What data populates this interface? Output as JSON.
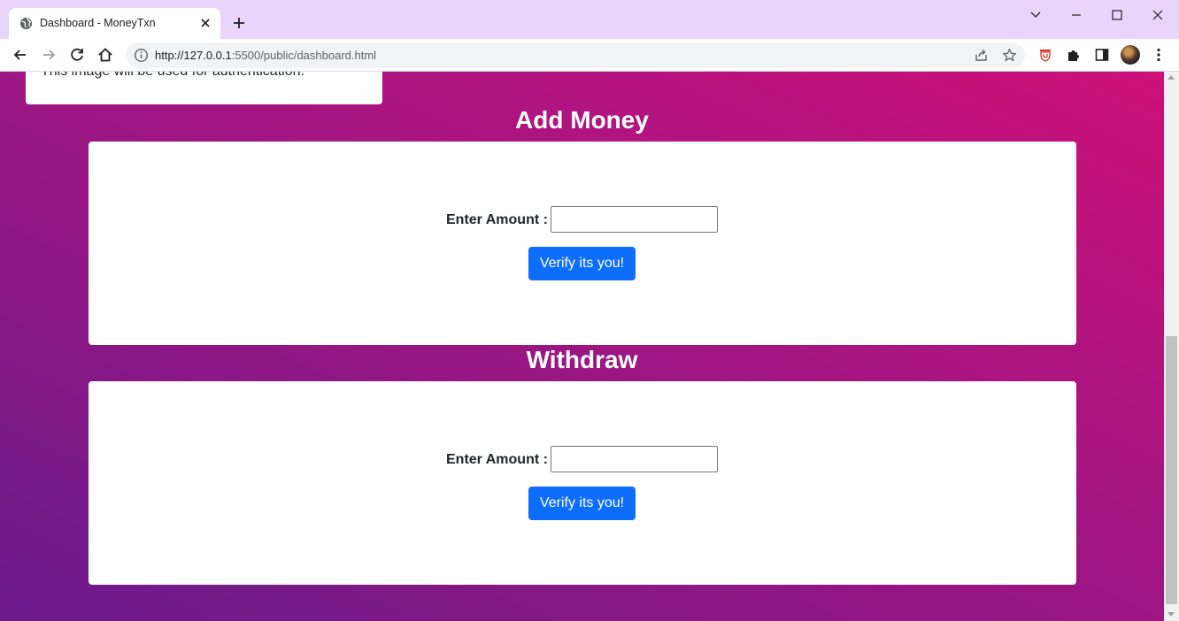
{
  "browser": {
    "tab_title": "Dashboard - MoneyTxn",
    "url_host": "http://127.0.0.1",
    "url_rest": ":5500/public/dashboard.html",
    "icons": [
      "globe-icon",
      "close-icon",
      "plus-icon",
      "back-icon",
      "forward-icon",
      "reload-icon",
      "home-icon",
      "info-icon",
      "share-icon",
      "star-icon",
      "extension-shield-icon",
      "puzzle-icon",
      "side-panel-icon",
      "profile-avatar",
      "menu-icon",
      "chevron-down-icon",
      "minimize-icon",
      "maximize-icon",
      "window-close-icon"
    ]
  },
  "page": {
    "auth_note": "This image will be used for authentication.",
    "add_money": {
      "title": "Add Money",
      "amount_label": "Enter Amount :",
      "amount_value": "",
      "button_label": "Verify its you!"
    },
    "withdraw": {
      "title": "Withdraw",
      "amount_label": "Enter Amount :",
      "amount_value": "",
      "button_label": "Verify its you!"
    }
  },
  "colors": {
    "gradient_start": "#6a1b8c",
    "gradient_end": "#cc1078",
    "button_primary": "#0d6efd",
    "titlebar": "#e9d5fb"
  }
}
